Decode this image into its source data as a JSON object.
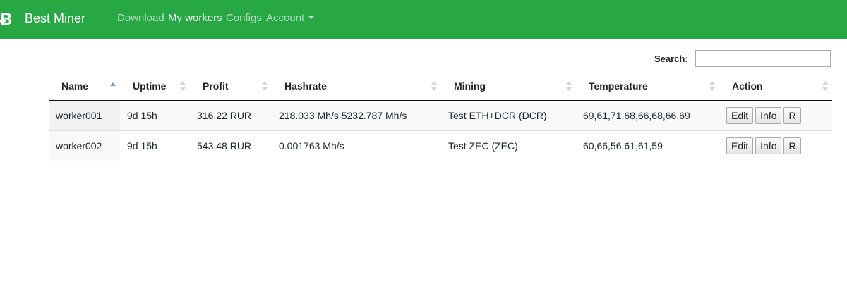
{
  "navbar": {
    "brand_icon": "Ƀ",
    "brand_name": "Best Miner",
    "links": [
      {
        "label": "Download",
        "active": false
      },
      {
        "label": "My workers",
        "active": true
      },
      {
        "label": "Configs",
        "active": false
      },
      {
        "label": "Account",
        "active": false
      }
    ],
    "background": "#28a745"
  },
  "search": {
    "label": "Search:",
    "value": ""
  },
  "table": {
    "columns": [
      "Name",
      "Uptime",
      "Profit",
      "Hashrate",
      "Mining",
      "Temperature",
      "Action"
    ],
    "sorted_column": "Name",
    "sort_direction": "asc",
    "rows": [
      {
        "name": "worker001",
        "uptime": "9d 15h",
        "profit": "316.22 RUR",
        "hashrate": "218.033 Mh/s 5232.787 Mh/s",
        "mining": "Test ETH+DCR (DCR)",
        "temperature": "69,61,71,68,66,68,66,69"
      },
      {
        "name": "worker002",
        "uptime": "9d 15h",
        "profit": "543.48 RUR",
        "hashrate": "0.001763 Mh/s",
        "mining": "Test ZEC (ZEC)",
        "temperature": "60,66,56,61,61,59"
      }
    ],
    "action_buttons": [
      "Edit",
      "Info",
      "R"
    ]
  }
}
